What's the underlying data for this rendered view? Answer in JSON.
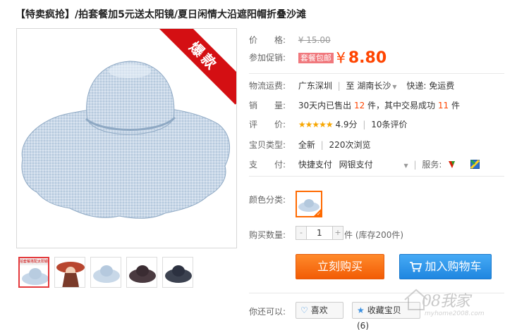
{
  "title": "【特卖疯抢】/拍套餐加5元送太阳镜/夏日闲情大沿遮阳帽折叠沙滩",
  "badge": "爆款",
  "thumb_tag": "拍套餐搭配太阳镜",
  "price": {
    "label": "价　　格:",
    "old": "¥ 15.00"
  },
  "promo": {
    "label": "参加促销:",
    "tag": "套餐包邮",
    "yen": "¥",
    "value": "8.80"
  },
  "shipping": {
    "label": "物流运费:",
    "from": "广东深圳",
    "sep": "|",
    "to_prefix": "至",
    "to": "湖南长沙",
    "express": "快递: 免运费"
  },
  "sales": {
    "label": "销　　量:",
    "prefix": "30天内已售出",
    "count": "12",
    "mid": "件，其中交易成功",
    "success": "11",
    "suffix": "件"
  },
  "rating": {
    "label": "评　　价:",
    "stars": "★★★★★",
    "score": "4.9分",
    "reviews": "10条评价"
  },
  "type": {
    "label": "宝贝类型:",
    "condition": "全新",
    "views": "220次浏览"
  },
  "payment": {
    "label": "支　　付:",
    "method1": "快捷支付",
    "method2": "网银支付",
    "service_label": "服务:"
  },
  "color": {
    "label": "颜色分类:"
  },
  "quantity": {
    "label": "购买数量:",
    "minus": "-",
    "value": "1",
    "plus": "+",
    "stock": "件 (库存200件)"
  },
  "actions": {
    "buy": "立刻购买",
    "cart": "加入购物车"
  },
  "social": {
    "label": "你还可以:",
    "like": "喜欢",
    "favorite": "收藏宝贝 (6)"
  },
  "watermark": {
    "text": "08我家",
    "url": "myhome2008.com"
  },
  "colors": {
    "accent": "#ff4400",
    "buy": "#f25c05",
    "cart": "#1f86e0",
    "badge": "#d40f13"
  }
}
